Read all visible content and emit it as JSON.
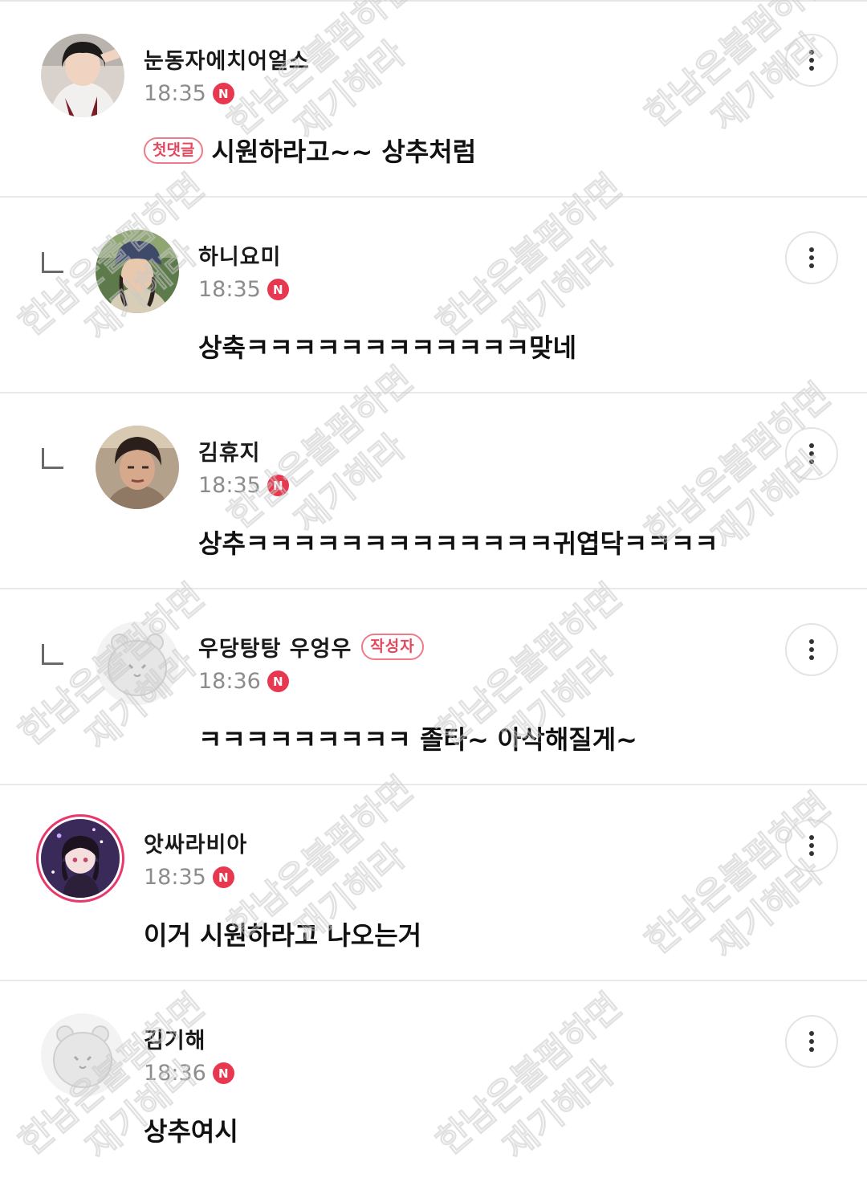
{
  "comments": [
    {
      "username": "눈동자에치어얼스",
      "time": "18:35",
      "badge": "N",
      "tag": "첫댓글",
      "text": "시원하라고~~ 상추처럼",
      "is_reply": false,
      "author_tag": ""
    },
    {
      "username": "하니요미",
      "time": "18:35",
      "badge": "N",
      "tag": "",
      "text": "상축ㅋㅋㅋㅋㅋㅋㅋㅋㅋㅋㅋㅋ맞네",
      "is_reply": true,
      "author_tag": ""
    },
    {
      "username": "김휴지",
      "time": "18:35",
      "badge": "N",
      "tag": "",
      "text": "상추ㅋㅋㅋㅋㅋㅋㅋㅋㅋㅋㅋㅋㅋ귀엽닥ㅋㅋㅋㅋ",
      "is_reply": true,
      "author_tag": ""
    },
    {
      "username": "우당탕탕 우엉우",
      "time": "18:36",
      "badge": "N",
      "tag": "",
      "text": "ㅋㅋㅋㅋㅋㅋㅋㅋㅋ 졸타~ 아삭해질게~",
      "is_reply": true,
      "author_tag": "작성자"
    },
    {
      "username": "앗싸라비아",
      "time": "18:35",
      "badge": "N",
      "tag": "",
      "text": "이거 시원하라고 나오는거",
      "is_reply": false,
      "author_tag": ""
    },
    {
      "username": "김기해",
      "time": "18:36",
      "badge": "N",
      "tag": "",
      "text": "상추여시",
      "is_reply": false,
      "author_tag": ""
    }
  ],
  "watermark": {
    "line1": "한남은불펌하면",
    "line2": "재기해라"
  },
  "icons": {
    "more": "more-vertical-icon",
    "new": "new-badge-icon",
    "reply": "reply-arrow-icon"
  },
  "colors": {
    "badge": "#e8384f",
    "pill_border": "#f07a8a",
    "pill_text": "#e5485e",
    "time": "#8c8c8c",
    "divider": "#e9e9e9"
  }
}
